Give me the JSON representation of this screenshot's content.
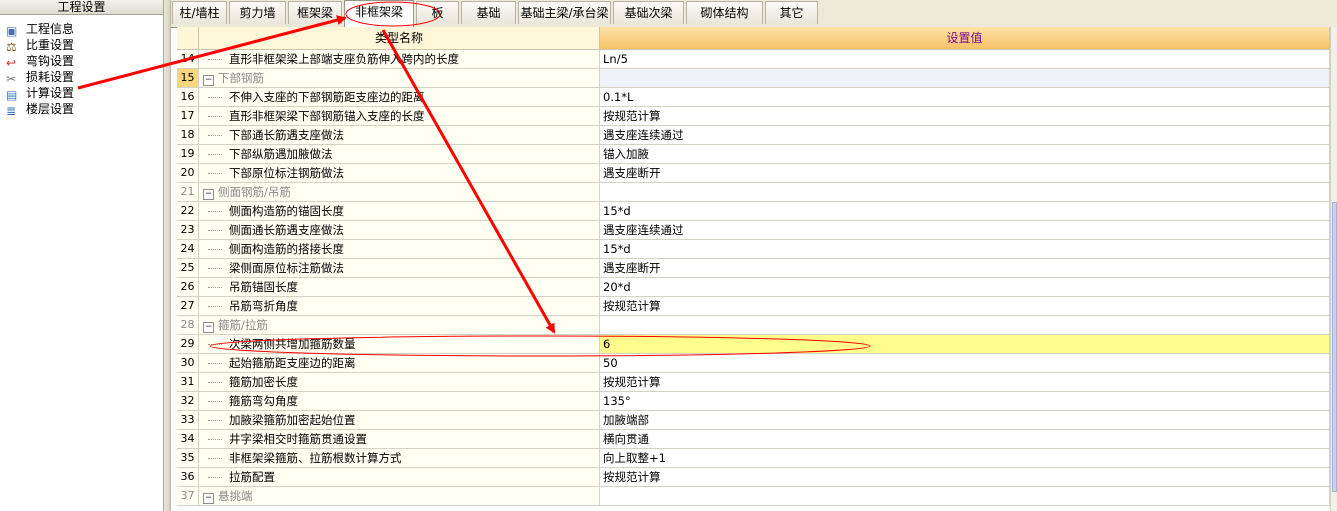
{
  "left_panel": {
    "title": "工程设置",
    "items": [
      {
        "label": "工程信息",
        "icon": "project-info-icon"
      },
      {
        "label": "比重设置",
        "icon": "weight-icon"
      },
      {
        "label": "弯钩设置",
        "icon": "hook-icon"
      },
      {
        "label": "损耗设置",
        "icon": "loss-icon"
      },
      {
        "label": "计算设置",
        "icon": "calc-settings-icon"
      },
      {
        "label": "楼层设置",
        "icon": "floor-settings-icon"
      }
    ]
  },
  "tabs": [
    "柱/墙柱",
    "剪力墙",
    "框架梁",
    "非框架梁",
    "板",
    "基础",
    "基础主梁/承台梁",
    "基础次梁",
    "砌体结构",
    "其它"
  ],
  "active_tab": "非框架梁",
  "grid": {
    "headers": {
      "name": "类型名称",
      "value": "设置值"
    },
    "rows": [
      {
        "num": "14",
        "name": "直形非框架梁上部端支座负筋伸入跨内的长度",
        "value": "Ln/5"
      },
      {
        "num": "15",
        "name": "下部钢筋",
        "value": "",
        "group": true
      },
      {
        "num": "16",
        "name": "不伸入支座的下部钢筋距支座边的距离",
        "value": "0.1*L"
      },
      {
        "num": "17",
        "name": "直形非框架梁下部钢筋锚入支座的长度",
        "value": "按规范计算"
      },
      {
        "num": "18",
        "name": "下部通长筋遇支座做法",
        "value": "遇支座连续通过"
      },
      {
        "num": "19",
        "name": "下部纵筋遇加腋做法",
        "value": "锚入加腋"
      },
      {
        "num": "20",
        "name": "下部原位标注钢筋做法",
        "value": "遇支座断开"
      },
      {
        "num": "21",
        "name": "侧面钢筋/吊筋",
        "value": "",
        "group": true
      },
      {
        "num": "22",
        "name": "侧面构造筋的锚固长度",
        "value": "15*d"
      },
      {
        "num": "23",
        "name": "侧面通长筋遇支座做法",
        "value": "遇支座连续通过"
      },
      {
        "num": "24",
        "name": "侧面构造筋的搭接长度",
        "value": "15*d"
      },
      {
        "num": "25",
        "name": "梁侧面原位标注筋做法",
        "value": "遇支座断开"
      },
      {
        "num": "26",
        "name": "吊筋锚固长度",
        "value": "20*d"
      },
      {
        "num": "27",
        "name": "吊筋弯折角度",
        "value": "按规范计算"
      },
      {
        "num": "28",
        "name": "箍筋/拉筋",
        "value": "",
        "group": true
      },
      {
        "num": "29",
        "name": "次梁两侧共增加箍筋数量",
        "value": "6",
        "selected": true
      },
      {
        "num": "30",
        "name": "起始箍筋距支座边的距离",
        "value": "50"
      },
      {
        "num": "31",
        "name": "箍筋加密长度",
        "value": "按规范计算"
      },
      {
        "num": "32",
        "name": "箍筋弯勾角度",
        "value": "135°"
      },
      {
        "num": "33",
        "name": "加腋梁箍筋加密起始位置",
        "value": "加腋端部"
      },
      {
        "num": "34",
        "name": "井字梁相交时箍筋贯通设置",
        "value": "横向贯通"
      },
      {
        "num": "35",
        "name": "非框架梁箍筋、拉筋根数计算方式",
        "value": "向上取整+1"
      },
      {
        "num": "36",
        "name": "拉筋配置",
        "value": "按规范计算"
      },
      {
        "num": "37",
        "name": "悬挑端",
        "value": "",
        "group": true
      }
    ]
  },
  "colors": {
    "header_value_bg": "#f9c97a",
    "header_name_bg": "#fff7d8",
    "selected_value_bg": "#fffe8c",
    "annotation": "#ff0000",
    "row15_num_bg": "#f6d67f"
  }
}
